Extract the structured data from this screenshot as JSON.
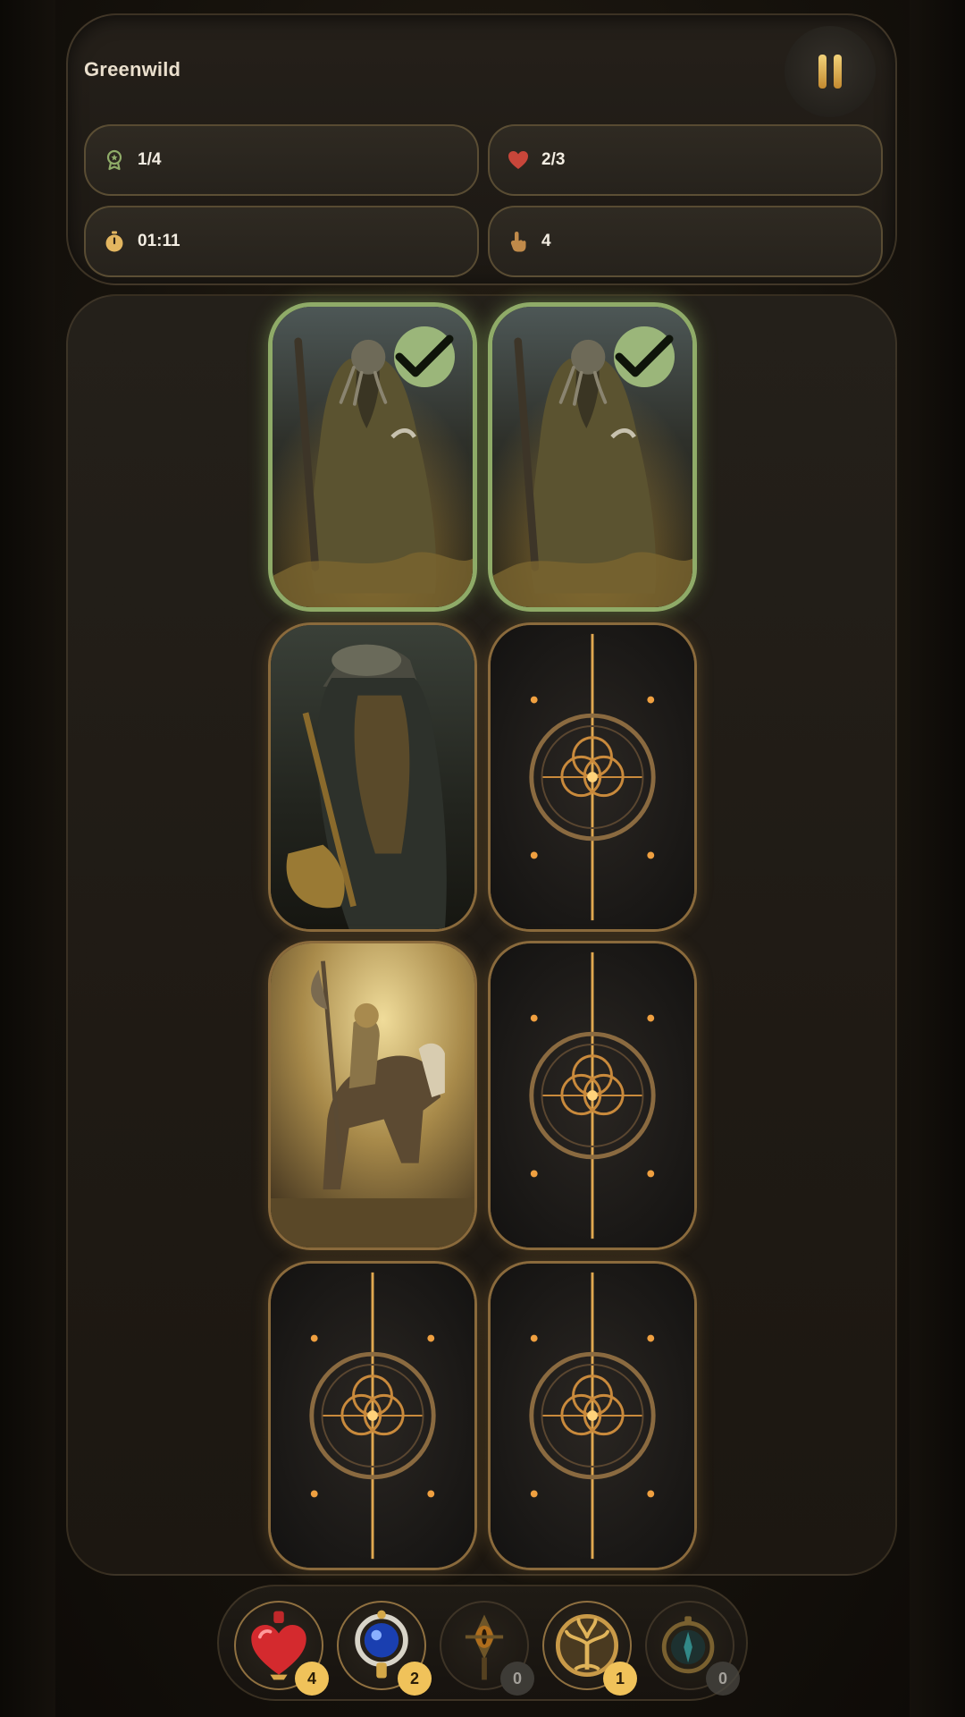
{
  "hud": {
    "level_title": "Greenwild",
    "stats": {
      "pairs": "1/4",
      "lives": "2/3",
      "timer": "01:11",
      "moves": "4"
    }
  },
  "board": {
    "rows": 4,
    "columns": 2,
    "cards": [
      {
        "state": "matched",
        "face": "robed-tentacle-mage"
      },
      {
        "state": "matched",
        "face": "robed-tentacle-mage"
      },
      {
        "state": "revealed",
        "face": "armored-axe-warrior"
      },
      {
        "state": "face-down",
        "face": "card-back"
      },
      {
        "state": "revealed",
        "face": "horseback-knight"
      },
      {
        "state": "face-down",
        "face": "card-back"
      },
      {
        "state": "face-down",
        "face": "card-back"
      },
      {
        "state": "face-down",
        "face": "card-back"
      }
    ]
  },
  "items": [
    {
      "icon": "heart-potion-icon",
      "count": "4"
    },
    {
      "icon": "blue-orb-amulet-icon",
      "count": "2"
    },
    {
      "icon": "eye-scepter-icon",
      "count": "0"
    },
    {
      "icon": "golden-tree-medallion-icon",
      "count": "1"
    },
    {
      "icon": "compass-icon",
      "count": "0"
    }
  ],
  "colors": {
    "accent_gold": "#f0c25a",
    "matched_green": "#8fab68",
    "heart_red": "#c8463a",
    "text_light": "#f3ede2"
  }
}
